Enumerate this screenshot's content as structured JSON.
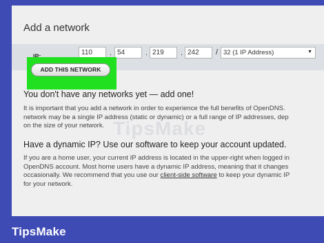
{
  "page": {
    "title": "Add a network",
    "ip_label": "IP:",
    "octets": [
      "110",
      "54",
      "219",
      "242"
    ],
    "dot": ".",
    "slash": "/",
    "cidr_selected": "32 (1 IP Address)",
    "add_button": "ADD THIS NETWORK"
  },
  "no_networks": {
    "heading": "You don't have any networks yet — add one!",
    "lines": [
      "It is important that you add a network in order to experience the full benefits of OpenDNS.",
      "network may be a single IP address (static or dynamic) or a full range of IP addresses, dep",
      "on the size of your network."
    ]
  },
  "dynamic_ip": {
    "heading": "Have a dynamic IP? Use our software to keep your account updated.",
    "lines": [
      "If you are a home user, your current IP address is located in the upper-right when logged in",
      "OpenDNS account. Most home users have a dynamic IP address, meaning that it changes"
    ],
    "line3_before": "occasionally. We recommend that you use our ",
    "link_text": "client-side software",
    "line3_after": " to keep your dynamic IP",
    "line4": "for your network."
  },
  "brand": "TipsMake",
  "watermark": "TipsMake",
  "colors": {
    "frame": "#3f4bb5",
    "highlight": "#20e020",
    "panel": "#efefef"
  }
}
